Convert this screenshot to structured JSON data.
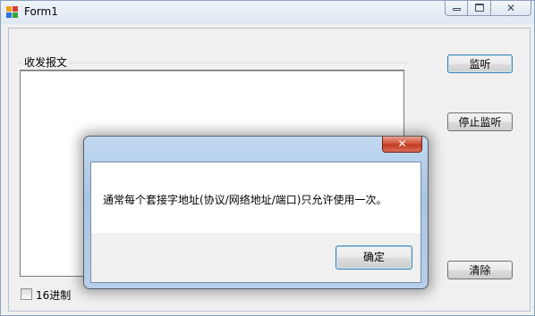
{
  "window": {
    "title": "Form1",
    "controls": {
      "minimize_icon": "minimize-icon",
      "maximize_icon": "maximize-icon",
      "close_glyph": "✕"
    }
  },
  "main": {
    "group_label": "收发报文",
    "buttons": {
      "listen": "监听",
      "stop_listen": "停止监听",
      "clear": "清除"
    },
    "checkbox": {
      "label": "16进制",
      "checked": false
    }
  },
  "dialog": {
    "message": "通常每个套接字地址(协议/网络地址/端口)只允许使用一次。",
    "ok_label": "确定",
    "close_glyph": "✕"
  }
}
